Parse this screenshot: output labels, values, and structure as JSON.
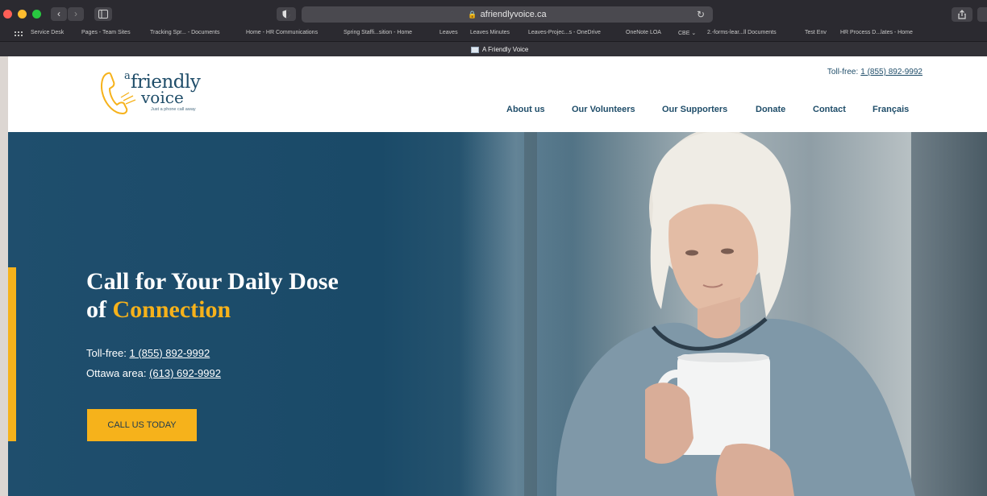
{
  "browser": {
    "url": "afriendlyvoice.ca",
    "tab_title": "A Friendly Voice",
    "bookmarks": [
      "Service Desk",
      "Pages - Team Sites",
      "Tracking Spr... - Documents",
      "Home - HR Communications",
      "Spring Staffi...sition - Home",
      "Leaves",
      "Leaves Minutes",
      "Leaves-Projec...s - OneDrive",
      "OneNote LOA",
      "CBE ⌄",
      "2.-forms-lear...ll Documents",
      "Test Env",
      "HR Process D...lates - Home"
    ]
  },
  "logo": {
    "a": "a",
    "friendly": "friendly",
    "voice": "voice",
    "tagline": "Just a phone call away"
  },
  "header": {
    "tollfree_label": "Toll-free:",
    "tollfree_number": "1 (855) 892-9992",
    "nav": [
      "About us",
      "Our Volunteers",
      "Our Supporters",
      "Donate",
      "Contact",
      "Français"
    ]
  },
  "hero": {
    "title_line1": "Call for Your Daily Dose",
    "title_of": "of",
    "title_highlight": "Connection",
    "tollfree_label": "Toll-free:",
    "tollfree_number": "1 (855) 892-9992",
    "ottawa_label": "Ottawa area:",
    "ottawa_number": "(613) 692-9992",
    "cta_label": "CALL US TODAY"
  },
  "colors": {
    "brand_navy": "#1f4d69",
    "accent_yellow": "#f6b21b",
    "hero_blue": "#1f4e6d"
  }
}
